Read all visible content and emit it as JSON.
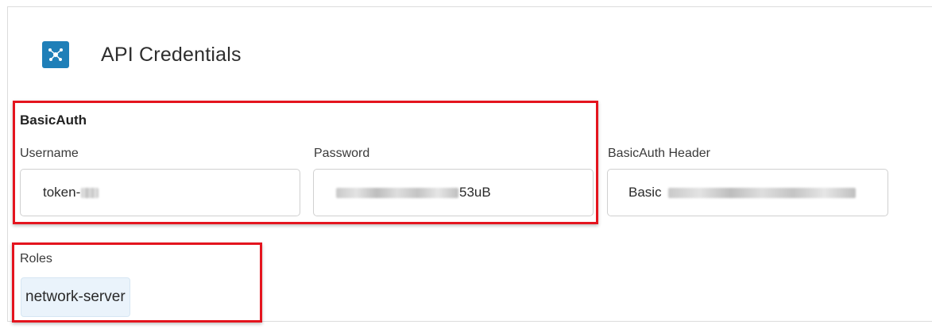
{
  "panel": {
    "title": "API Credentials",
    "icon": "network-nodes-icon",
    "accent_color": "#1f7fb8"
  },
  "basic_auth": {
    "section_label": "BasicAuth",
    "username": {
      "label": "Username",
      "value_visible": "token-"
    },
    "password": {
      "label": "Password",
      "value_visible": "53uB"
    }
  },
  "basic_auth_header": {
    "label": "BasicAuth Header",
    "value_visible": "Basic"
  },
  "roles": {
    "label": "Roles",
    "items": [
      "network-server"
    ]
  },
  "highlight_color": "#e4141e"
}
